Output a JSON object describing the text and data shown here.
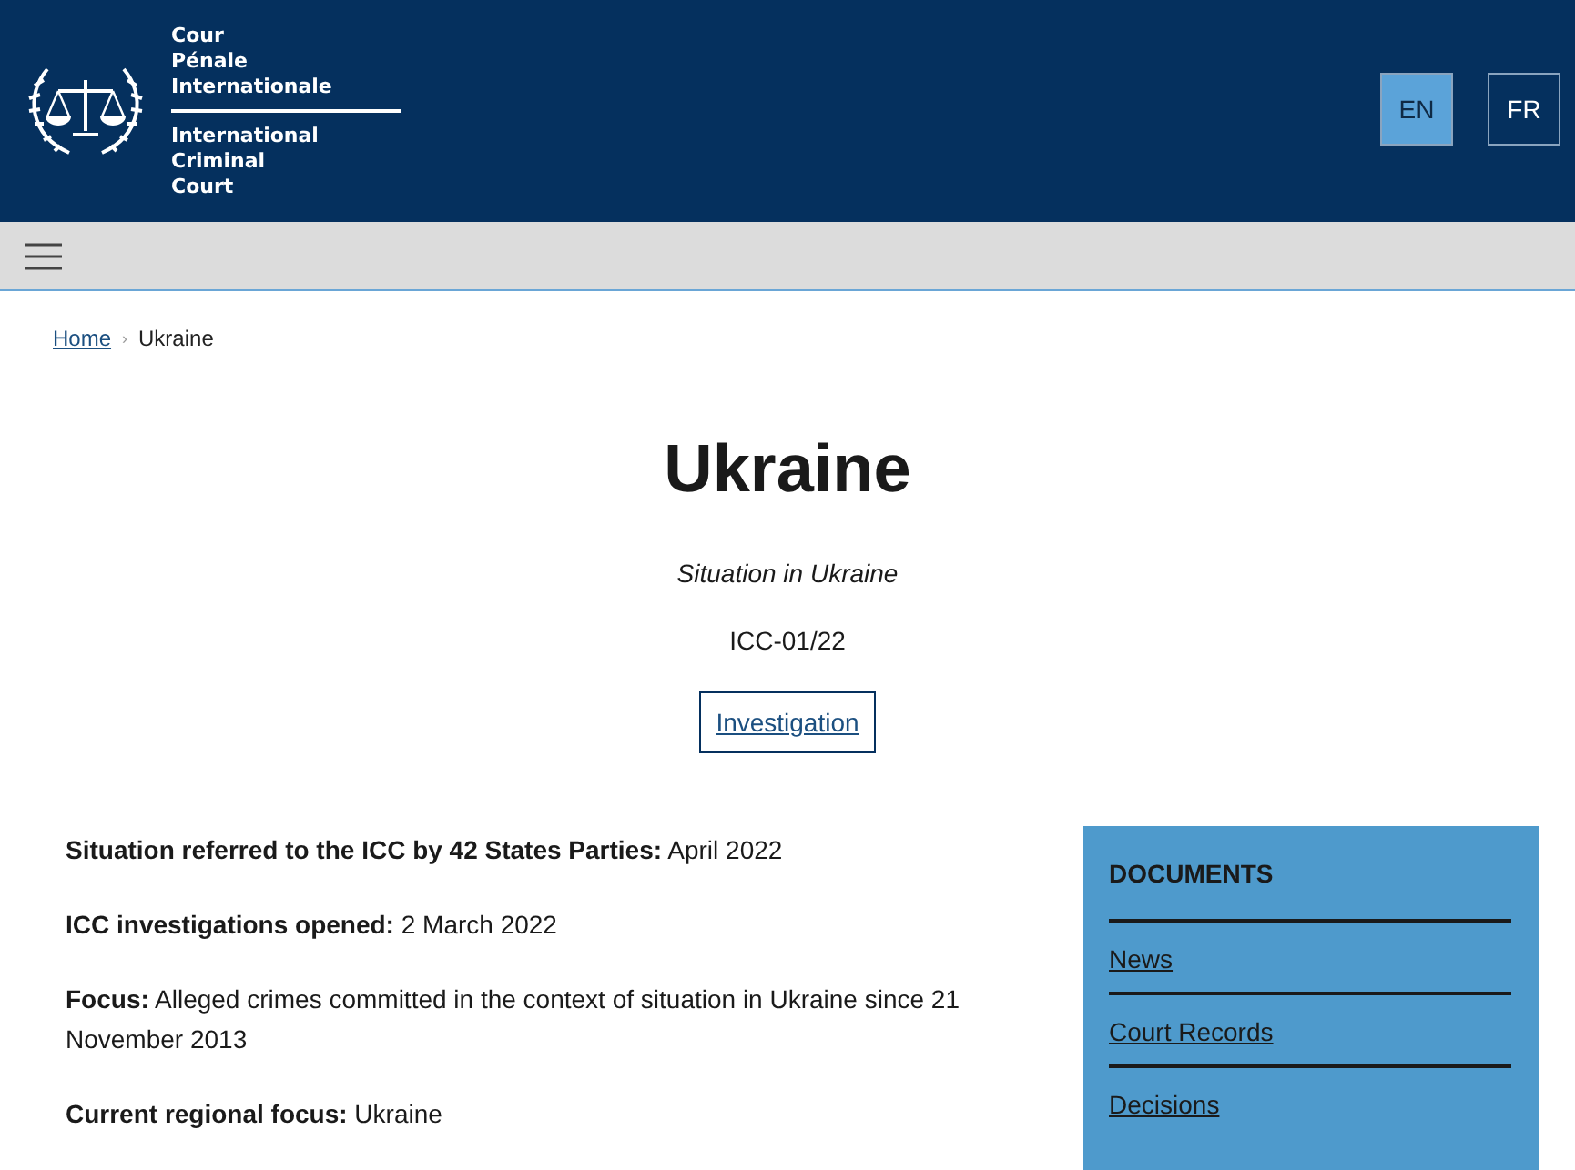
{
  "header": {
    "logo_lines_fr": [
      "Cour",
      "Pénale",
      "Internationale"
    ],
    "logo_lines_en": [
      "International",
      "Criminal",
      "Court"
    ],
    "languages": [
      {
        "label": "EN",
        "selected": true
      },
      {
        "label": "FR",
        "selected": false
      }
    ]
  },
  "breadcrumb": [
    {
      "label": "Home",
      "kind": "link"
    },
    {
      "label": "›",
      "kind": "separator"
    },
    {
      "label": "Ukraine",
      "kind": "current"
    }
  ],
  "title": "Ukraine",
  "subtitle": "Situation in Ukraine",
  "case_code": "ICC-01/22",
  "tag": "Investigation",
  "facts": [
    "**Situation referred to the ICC by 42 States Parties:** April 2022",
    "**ICC investigations opened:** 2 March 2022",
    "**Focus:** Alleged crimes committed in the context of situation in Ukraine since 21 November 2013",
    "**Current regional focus:** Ukraine"
  ],
  "documents": {
    "heading": "DOCUMENTS",
    "links": [
      "News",
      "Court Records",
      "Decisions"
    ]
  }
}
